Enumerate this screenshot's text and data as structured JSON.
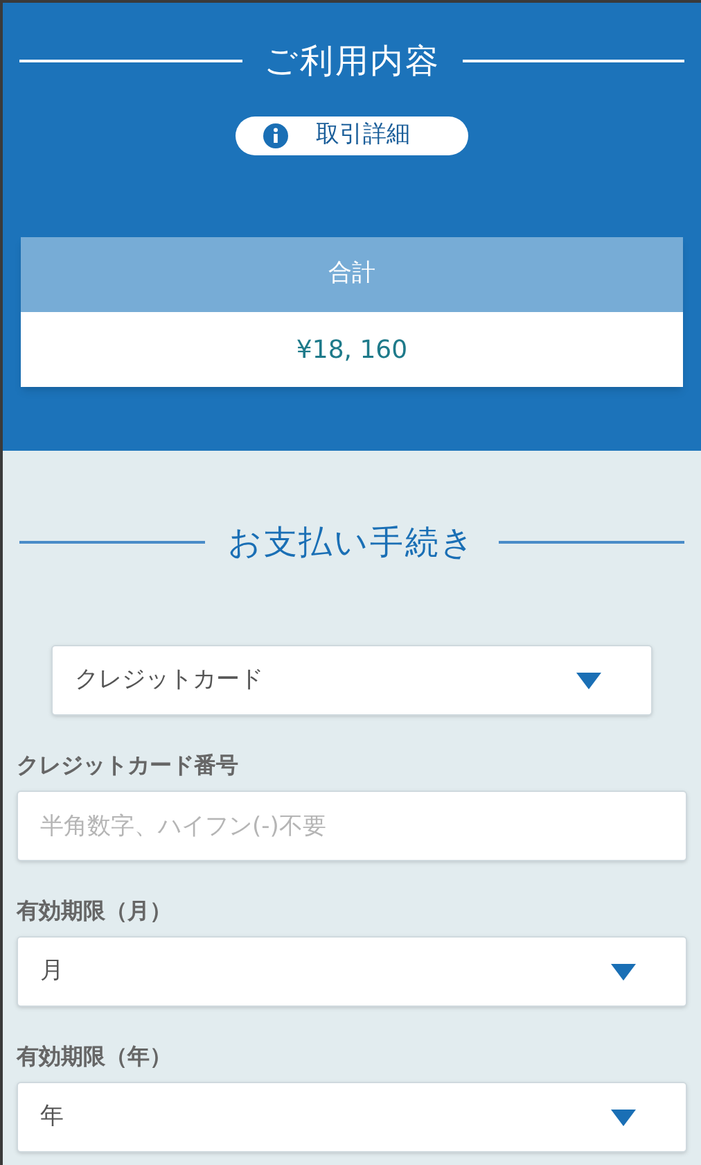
{
  "summary": {
    "title": "ご利用内容",
    "details_button": "取引詳細",
    "total_label": "合計",
    "total_value": "¥18, 160"
  },
  "payment": {
    "title": "お支払い手続き",
    "method": {
      "kind": "select",
      "value": "クレジットカード"
    },
    "fields": [
      {
        "kind": "text",
        "label": "クレジットカード番号",
        "placeholder": "半角数字、ハイフン(-)不要"
      },
      {
        "kind": "select",
        "label": "有効期限（月）",
        "value": "月"
      },
      {
        "kind": "select",
        "label": "有効期限（年）",
        "value": "年"
      }
    ]
  }
}
